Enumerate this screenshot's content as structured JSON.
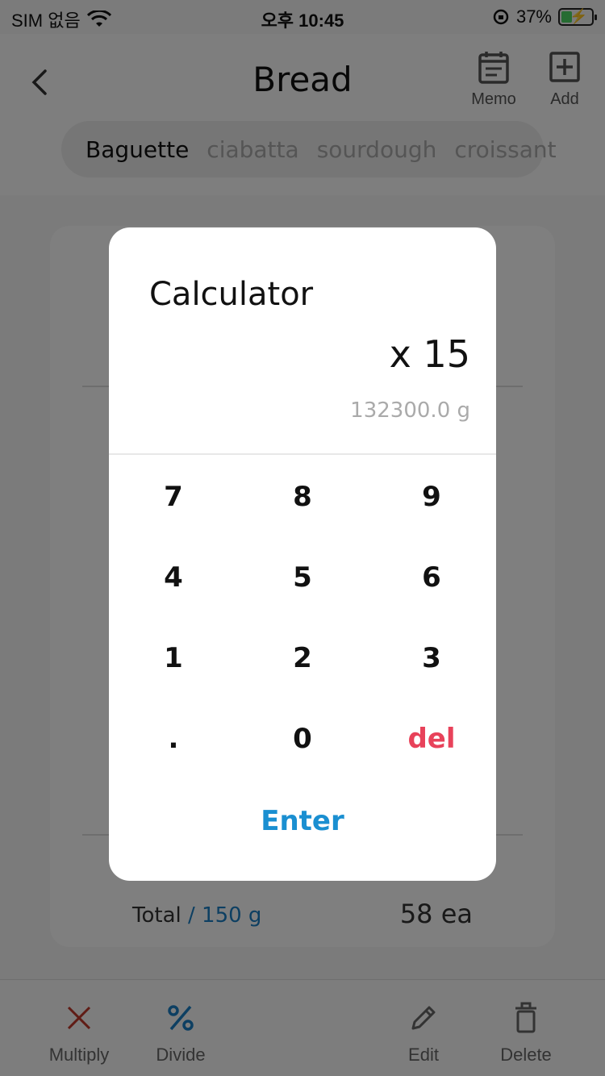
{
  "status_bar": {
    "carrier": "SIM 없음",
    "time": "오후 10:45",
    "battery": "37%",
    "battery_level": 0.37
  },
  "header": {
    "title": "Bread",
    "memo_label": "Memo",
    "add_label": "Add"
  },
  "tabs": [
    {
      "label": "Baguette",
      "active": true
    },
    {
      "label": "ciabatta",
      "active": false
    },
    {
      "label": "sourdough",
      "active": false
    },
    {
      "label": "croissant",
      "active": false
    }
  ],
  "card": {
    "total_label": "Total",
    "total_weight": "/ 150 g",
    "count": "58 ea"
  },
  "bottom_bar": {
    "multiply": "Multiply",
    "divide": "Divide",
    "edit": "Edit",
    "delete": "Delete"
  },
  "calculator": {
    "title": "Calculator",
    "expression": "x 15",
    "result": "132300.0 g",
    "keys": [
      "7",
      "8",
      "9",
      "4",
      "5",
      "6",
      "1",
      "2",
      "3",
      ".",
      "0",
      "del"
    ],
    "enter": "Enter"
  },
  "colors": {
    "accent": "#1a8fd1",
    "delete": "#e8425a",
    "multiply_icon": "#c0392b"
  }
}
